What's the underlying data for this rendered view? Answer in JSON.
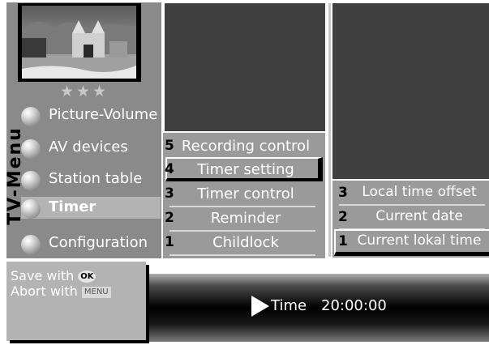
{
  "side_title": "TV-Menu",
  "rating": "★★★",
  "main_menu": [
    {
      "label": "Picture-Volume"
    },
    {
      "label": "AV devices"
    },
    {
      "label": "Station table"
    },
    {
      "label": "Timer",
      "active": true
    },
    {
      "label": "Configuration"
    }
  ],
  "timer_submenu": [
    {
      "num": "5",
      "label": "Recording control"
    },
    {
      "num": "4",
      "label": "Timer setting",
      "selected": true
    },
    {
      "num": "3",
      "label": "Timer control"
    },
    {
      "num": "2",
      "label": "Reminder"
    },
    {
      "num": "1",
      "label": "Childlock"
    }
  ],
  "timer_setting_submenu": [
    {
      "num": "3",
      "label": "Local time offset"
    },
    {
      "num": "2",
      "label": "Current date"
    },
    {
      "num": "1",
      "label": "Current lokal time",
      "selected": true
    }
  ],
  "help": {
    "save_label": "Save with",
    "ok_key": "OK",
    "abort_label": "Abort with",
    "menu_key": "MENU"
  },
  "status": {
    "time_label": "Time",
    "time_value": "20:00:00"
  },
  "colors": {
    "panel_grey": "#8a8a8a",
    "menu_grey": "#9a9a9a",
    "highlight": "#b3b3b3",
    "text": "#ffffff"
  }
}
